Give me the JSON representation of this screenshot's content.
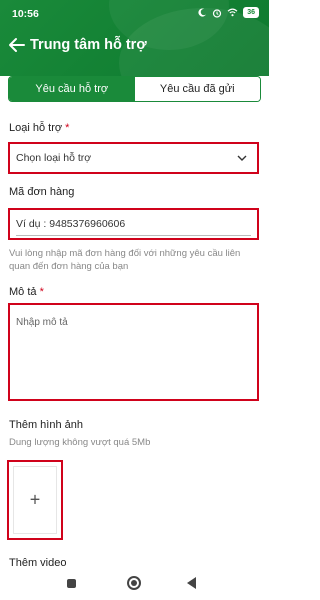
{
  "status_bar": {
    "time": "10:56",
    "battery": "36"
  },
  "header": {
    "title": "Trung tâm hỗ trợ"
  },
  "tabs": [
    {
      "label": "Yêu cầu hỗ trợ",
      "active": true
    },
    {
      "label": "Yêu cầu đã gửi",
      "active": false
    }
  ],
  "support_type": {
    "label": "Loại hỗ trợ",
    "required_mark": "*",
    "value": "Chọn loại hỗ trợ"
  },
  "order_code": {
    "label": "Mã đơn hàng",
    "placeholder": "Ví dụ : 9485376960606",
    "help": "Vui lòng nhập mã đơn hàng đối với những yêu cầu liên quan đến đơn hàng của bạn"
  },
  "description": {
    "label": "Mô tả",
    "required_mark": "*",
    "placeholder": "Nhập mô tả"
  },
  "images": {
    "label": "Thêm hình ảnh",
    "help": "Dung lượng không vượt quá 5Mb",
    "add_symbol": "+"
  },
  "video": {
    "label": "Thêm video"
  },
  "colors": {
    "brand": "#1a8a3a",
    "error": "#d0021b"
  }
}
